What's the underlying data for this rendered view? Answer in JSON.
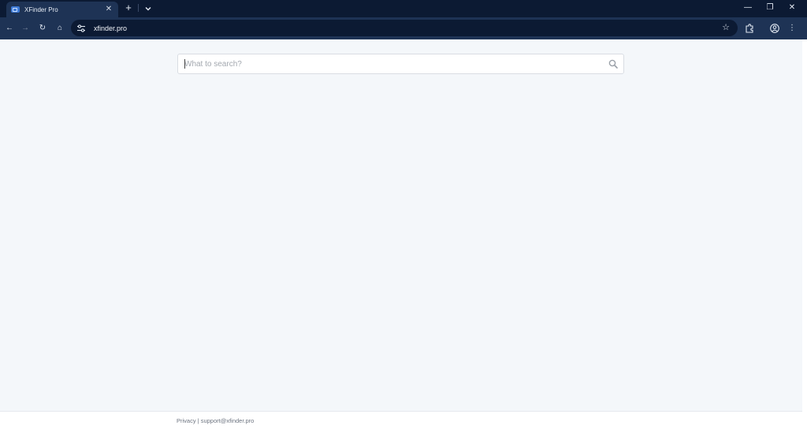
{
  "browser": {
    "tab": {
      "title": "XFinder Pro",
      "close_glyph": "✕",
      "favicon": "xfinder-favicon-icon"
    },
    "new_tab_glyph": "+",
    "tab_search_icon": "chevron-down-icon",
    "window_controls": {
      "minimize": "—",
      "restore": "❐",
      "close": "✕"
    },
    "nav": {
      "back": "←",
      "forward": "→",
      "reload": "↻",
      "home": "⌂"
    },
    "omnibox": {
      "url": "xfinder.pro",
      "site_info_icon": "tune-icon",
      "bookmark_glyph": "☆"
    },
    "extensions_icon": "puzzle-icon",
    "profile_icon": "account-circle-icon",
    "menu_glyph": "⋮"
  },
  "page": {
    "search": {
      "placeholder": "What to search?",
      "value": ""
    },
    "footer": {
      "text": "Privacy | support@xfinder.pro"
    }
  },
  "colors": {
    "tabstrip": "#0c1a33",
    "toolbar": "#1e3355",
    "page_background": "#f4f7fa"
  }
}
